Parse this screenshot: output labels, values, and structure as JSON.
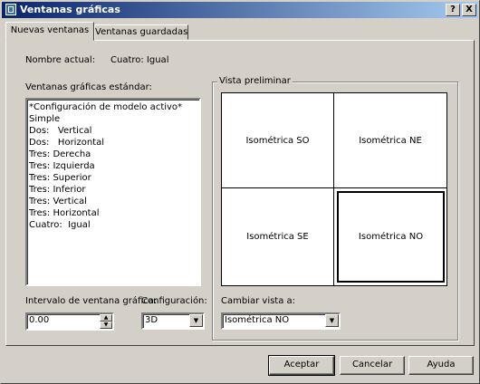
{
  "window": {
    "title": "Ventanas gráficas",
    "help_label": "?",
    "close_label": "X"
  },
  "tabs": [
    {
      "label": "Nuevas ventanas"
    },
    {
      "label": "Ventanas guardadas"
    }
  ],
  "current_name": {
    "label": "Nombre actual:",
    "value": "Cuatro:  Igual"
  },
  "standard_viewports": {
    "label": "Ventanas gráficas estándar:",
    "items": [
      "*Configuración de modelo activo*",
      "Simple",
      "Dos:   Vertical",
      "Dos:   Horizontal",
      "Tres: Derecha",
      "Tres: Izquierda",
      "Tres: Superior",
      "Tres: Inferior",
      "Tres: Vertical",
      "Tres: Horizontal",
      "Cuatro:  Igual"
    ]
  },
  "preview": {
    "label": "Vista preliminar",
    "viewports": [
      "Isométrica SO",
      "Isométrica NE",
      "Isométrica SE",
      "Isométrica NO"
    ]
  },
  "spacing": {
    "label": "Intervalo de ventana gráfica:",
    "value": "0.00"
  },
  "setup": {
    "label": "Configuración:",
    "value": "3D"
  },
  "change_view": {
    "label": "Cambiar vista a:",
    "value": "Isométrica NO"
  },
  "buttons": {
    "ok": "Aceptar",
    "cancel": "Cancelar",
    "help": "Ayuda"
  }
}
